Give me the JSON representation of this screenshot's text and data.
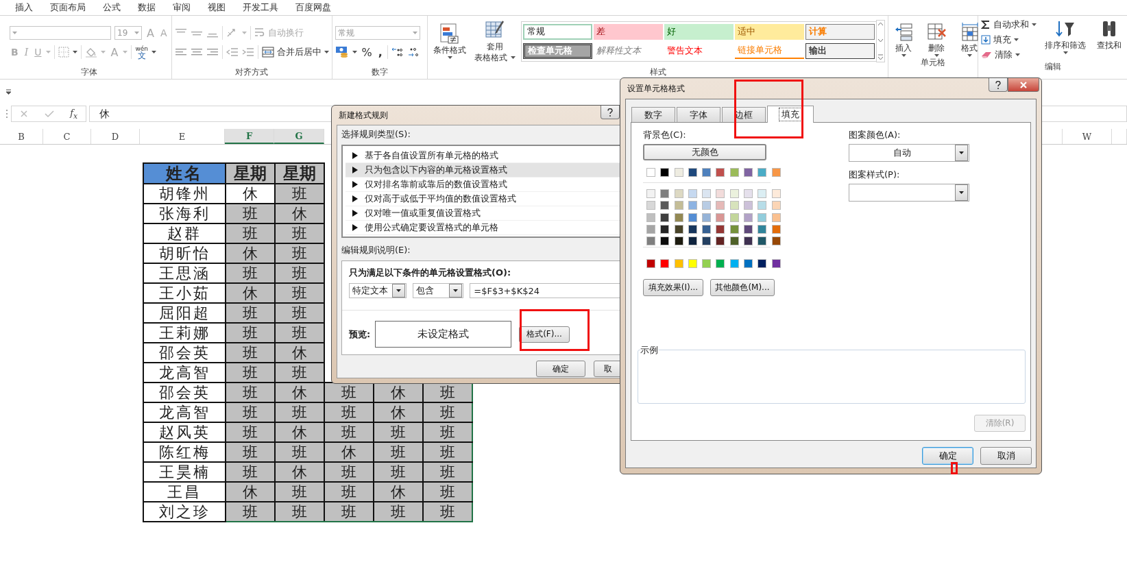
{
  "ribbon_tabs": [
    {
      "label": "插入",
      "selected": false
    },
    {
      "label": "页面布局",
      "selected": false
    },
    {
      "label": "公式",
      "selected": false
    },
    {
      "label": "数据",
      "selected": false
    },
    {
      "label": "审阅",
      "selected": false
    },
    {
      "label": "视图",
      "selected": false
    },
    {
      "label": "开发工具",
      "selected": false
    },
    {
      "label": "百度网盘",
      "selected": false
    }
  ],
  "ribbon_groups": [
    {
      "kind": "font",
      "label": "字体",
      "disabled": true,
      "size": "19",
      "grow": "A",
      "shrink": "A",
      "bold": "B",
      "italic": "I",
      "underline": "U",
      "font_color": "A",
      "phonetic_top": "wén",
      "phonetic_bottom": "文"
    },
    {
      "kind": "alignment",
      "label": "对齐方式",
      "wrap": {
        "label": "自动换行",
        "disabled": true
      },
      "merge": {
        "label": "合并后居中",
        "disabled": false
      }
    },
    {
      "kind": "number",
      "label": "数字",
      "format": {
        "value": "常规",
        "disabled": true
      },
      "percent": "%",
      "comma": ","
    },
    {
      "kind": "styles",
      "label": "样式",
      "conditional": "条件格式",
      "table_top": "套用",
      "table_bottom": "表格格式",
      "gallery": [
        {
          "kind": "normal",
          "label": "常规"
        },
        {
          "kind": "bad",
          "label": "差"
        },
        {
          "kind": "good",
          "label": "好"
        },
        {
          "kind": "neutral",
          "label": "适中"
        },
        {
          "kind": "calculation",
          "label": "计算"
        },
        {
          "kind": "check",
          "label": "检查单元格"
        },
        {
          "kind": "explanatory",
          "label": "解释性文本"
        },
        {
          "kind": "warning",
          "label": "警告文本"
        },
        {
          "kind": "link",
          "label": "链接单元格"
        },
        {
          "kind": "output",
          "label": "输出"
        }
      ]
    },
    {
      "kind": "cells",
      "label": "单元格",
      "insert": "插入",
      "delete": "删除",
      "format": "格式"
    },
    {
      "kind": "editing",
      "label": "编辑",
      "autosum": "自动求和",
      "fill": "填充",
      "clear": "清除",
      "sort": "排序和筛选",
      "find": "查找和"
    }
  ],
  "formula_bar": {
    "function_label": "f$_{x}$",
    "value": "休"
  },
  "columns": [
    {
      "label": "B",
      "selected": false
    },
    {
      "label": "C",
      "selected": false
    },
    {
      "label": "D",
      "selected": false
    },
    {
      "label": "E",
      "selected": false
    },
    {
      "label": "F",
      "selected": true
    },
    {
      "label": "G",
      "selected": true
    },
    {
      "label": "W",
      "selected": false
    }
  ],
  "table": {
    "header": [
      "姓名",
      "星期",
      "星期"
    ],
    "rows": [
      {
        "name": "胡锋州",
        "cells": [
          {
            "text": "休",
            "selected": true
          },
          {
            "text": "班",
            "selected": false
          }
        ]
      },
      {
        "name": "张海利",
        "cells": [
          {
            "text": "班",
            "selected": false
          },
          {
            "text": "休",
            "selected": false
          }
        ]
      },
      {
        "name": "赵群",
        "cells": [
          {
            "text": "班",
            "selected": false
          },
          {
            "text": "班",
            "selected": false
          }
        ]
      },
      {
        "name": "胡昕怡",
        "cells": [
          {
            "text": "休",
            "selected": false
          },
          {
            "text": "班",
            "selected": false
          }
        ]
      },
      {
        "name": "王思涵",
        "cells": [
          {
            "text": "班",
            "selected": false
          },
          {
            "text": "班",
            "selected": false
          }
        ]
      },
      {
        "name": "王小茹",
        "cells": [
          {
            "text": "休",
            "selected": false
          },
          {
            "text": "班",
            "selected": false
          }
        ]
      },
      {
        "name": "屈阳超",
        "cells": [
          {
            "text": "班",
            "selected": false
          },
          {
            "text": "班",
            "selected": false
          }
        ]
      },
      {
        "name": "王莉娜",
        "cells": [
          {
            "text": "班",
            "selected": false
          },
          {
            "text": "班",
            "selected": false
          }
        ]
      },
      {
        "name": "邵会英",
        "cells": [
          {
            "text": "班",
            "selected": false
          },
          {
            "text": "休",
            "selected": false
          }
        ]
      },
      {
        "name": "龙高智",
        "cells": [
          {
            "text": "班",
            "selected": false
          },
          {
            "text": "班",
            "selected": false
          }
        ]
      },
      {
        "name": "邵会英",
        "cells": [
          {
            "text": "班",
            "selected": false
          },
          {
            "text": "休",
            "selected": false
          },
          {
            "text": "班",
            "selected": false
          },
          {
            "text": "休",
            "selected": false
          },
          {
            "text": "班",
            "selected": false
          }
        ]
      },
      {
        "name": "龙高智",
        "cells": [
          {
            "text": "班",
            "selected": false
          },
          {
            "text": "班",
            "selected": false
          },
          {
            "text": "班",
            "selected": false
          },
          {
            "text": "休",
            "selected": false
          },
          {
            "text": "班",
            "selected": false
          }
        ]
      },
      {
        "name": "赵风英",
        "cells": [
          {
            "text": "班",
            "selected": false
          },
          {
            "text": "休",
            "selected": false
          },
          {
            "text": "班",
            "selected": false
          },
          {
            "text": "班",
            "selected": false
          },
          {
            "text": "班",
            "selected": false
          }
        ]
      },
      {
        "name": "陈红梅",
        "cells": [
          {
            "text": "班",
            "selected": false
          },
          {
            "text": "班",
            "selected": false
          },
          {
            "text": "休",
            "selected": false
          },
          {
            "text": "班",
            "selected": false
          },
          {
            "text": "班",
            "selected": false
          }
        ]
      },
      {
        "name": "王昊楠",
        "cells": [
          {
            "text": "班",
            "selected": false
          },
          {
            "text": "休",
            "selected": false
          },
          {
            "text": "班",
            "selected": false
          },
          {
            "text": "班",
            "selected": false
          },
          {
            "text": "班",
            "selected": false
          }
        ]
      },
      {
        "name": "王昌",
        "cells": [
          {
            "text": "休",
            "selected": false
          },
          {
            "text": "班",
            "selected": false
          },
          {
            "text": "班",
            "selected": false
          },
          {
            "text": "休",
            "selected": false
          },
          {
            "text": "班",
            "selected": false
          }
        ]
      },
      {
        "name": "刘之珍",
        "cells": [
          {
            "text": "班",
            "selected": false
          },
          {
            "text": "班",
            "selected": false
          },
          {
            "text": "班",
            "selected": false
          },
          {
            "text": "班",
            "selected": false
          },
          {
            "text": "班",
            "selected": false
          }
        ]
      }
    ]
  },
  "new_rule_dialog": {
    "title": "新建格式规则",
    "type_label": "选择规则类型(S):",
    "rule_types": [
      {
        "label": "基于各自值设置所有单元格的格式",
        "selected": false
      },
      {
        "label": "只为包含以下内容的单元格设置格式",
        "selected": true
      },
      {
        "label": "仅对排名靠前或靠后的数值设置格式",
        "selected": false
      },
      {
        "label": "仅对高于或低于平均值的数值设置格式",
        "selected": false
      },
      {
        "label": "仅对唯一值或重复值设置格式",
        "selected": false
      },
      {
        "label": "使用公式确定要设置格式的单元格",
        "selected": false
      }
    ],
    "edit_label": "编辑规则说明(E):",
    "condition_label": "只为满足以下条件的单元格设置格式(O):",
    "condition_type": "特定文本",
    "operator": "包含",
    "value": "=$F$3+$K$24",
    "preview_label": "预览:",
    "preview_text": "未设定格式",
    "format_button": "格式(F)...",
    "ok_button": "确定",
    "cancel_button": "取"
  },
  "format_cells_dialog": {
    "title": "设置单元格格式",
    "tabs": [
      {
        "label": "数字",
        "selected": false
      },
      {
        "label": "字体",
        "selected": false
      },
      {
        "label": "边框",
        "selected": false
      },
      {
        "label": "填充",
        "selected": true
      }
    ],
    "background_label": "背景色(C):",
    "no_color_button": "无颜色",
    "swatch_rows": [
      {
        "kind": "theme",
        "swatches": [
          {
            "color": "#ffffff"
          },
          {
            "color": "#000000"
          },
          {
            "color": "#eeece1"
          },
          {
            "color": "#1f497d"
          },
          {
            "color": "#4f81bd"
          },
          {
            "color": "#c0504d"
          },
          {
            "color": "#9bbb59"
          },
          {
            "color": "#8064a2"
          },
          {
            "color": "#4bacc6"
          },
          {
            "color": "#f79646"
          }
        ]
      },
      {
        "kind": "tint",
        "swatches": [
          {
            "color": "#f2f2f2"
          },
          {
            "color": "#7f7f7f"
          },
          {
            "color": "#ddd9c3"
          },
          {
            "color": "#c6d9f0"
          },
          {
            "color": "#dbe5f1"
          },
          {
            "color": "#f2dcdb"
          },
          {
            "color": "#ebf1dd"
          },
          {
            "color": "#e5e0ec"
          },
          {
            "color": "#dbeef3"
          },
          {
            "color": "#fdeada"
          }
        ]
      },
      {
        "kind": "tint",
        "swatches": [
          {
            "color": "#d8d8d8"
          },
          {
            "color": "#595959"
          },
          {
            "color": "#c4bd97"
          },
          {
            "color": "#8db3e2"
          },
          {
            "color": "#b8cce4"
          },
          {
            "color": "#e5b9b7"
          },
          {
            "color": "#d7e3bc"
          },
          {
            "color": "#ccc1d9"
          },
          {
            "color": "#b7dde8"
          },
          {
            "color": "#fbd5b5"
          }
        ]
      },
      {
        "kind": "tint",
        "swatches": [
          {
            "color": "#bfbfbf"
          },
          {
            "color": "#3f3f3f"
          },
          {
            "color": "#938953"
          },
          {
            "color": "#548dd4"
          },
          {
            "color": "#95b3d7"
          },
          {
            "color": "#d99694"
          },
          {
            "color": "#c3d69b"
          },
          {
            "color": "#b2a2c7"
          },
          {
            "color": "#92cddc"
          },
          {
            "color": "#fac08f"
          }
        ]
      },
      {
        "kind": "tint",
        "swatches": [
          {
            "color": "#a5a5a5"
          },
          {
            "color": "#262626"
          },
          {
            "color": "#494429"
          },
          {
            "color": "#17365d"
          },
          {
            "color": "#366092"
          },
          {
            "color": "#953734"
          },
          {
            "color": "#76923c"
          },
          {
            "color": "#5f497a"
          },
          {
            "color": "#31859b"
          },
          {
            "color": "#e36c09"
          }
        ]
      },
      {
        "kind": "tint",
        "swatches": [
          {
            "color": "#7f7f7f"
          },
          {
            "color": "#0c0c0c"
          },
          {
            "color": "#1d1b10"
          },
          {
            "color": "#0f243e"
          },
          {
            "color": "#244061"
          },
          {
            "color": "#632423"
          },
          {
            "color": "#4f6128"
          },
          {
            "color": "#3f3151"
          },
          {
            "color": "#205867"
          },
          {
            "color": "#974806"
          }
        ]
      },
      {
        "kind": "standard",
        "swatches": [
          {
            "color": "#c00000"
          },
          {
            "color": "#ff0000"
          },
          {
            "color": "#ffc000"
          },
          {
            "color": "#ffff00"
          },
          {
            "color": "#92d050"
          },
          {
            "color": "#00b050"
          },
          {
            "color": "#00b0f0"
          },
          {
            "color": "#0070c0"
          },
          {
            "color": "#002060"
          },
          {
            "color": "#7030a0"
          }
        ]
      }
    ],
    "fill_effects_button": "填充效果(I)...",
    "more_colors_button": "其他颜色(M)...",
    "pattern_color_label": "图案颜色(A):",
    "pattern_color": "自动",
    "pattern_style_label": "图案样式(P):",
    "sample_label": "示例",
    "clear_button": {
      "label": "清除(R)",
      "disabled": true
    },
    "ok_button": "确定",
    "cancel_button": "取消"
  },
  "annotations": [
    {
      "kind": "frame"
    },
    {
      "kind": "frame"
    },
    {
      "kind": "frame"
    }
  ]
}
